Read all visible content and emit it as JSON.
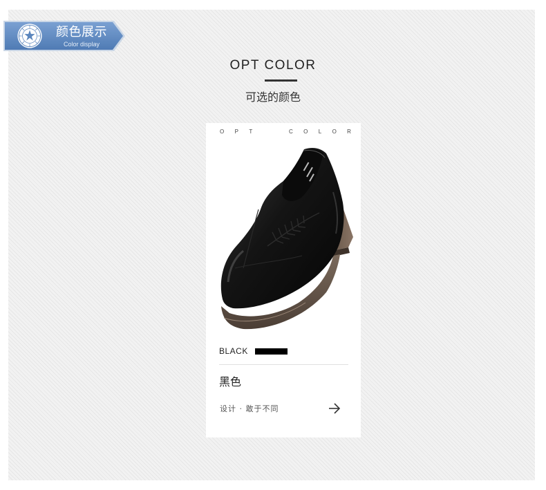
{
  "banner": {
    "title_cn": "颜色展示",
    "title_en": "Color display",
    "logo_icon": "brand-seal-icon",
    "color": "#5b86bd"
  },
  "heading": {
    "title_en": "OPT COLOR",
    "subtitle_cn": "可选的颜色"
  },
  "card": {
    "caption_letters": [
      "O",
      "P",
      "T",
      "C",
      "O",
      "L",
      "O",
      "R"
    ],
    "color_name_en": "BLACK",
    "swatch_color": "#000000",
    "color_name_cn": "黑色",
    "slogan": "设计 · 敢于不同",
    "arrow_icon": "arrow-right-icon"
  }
}
